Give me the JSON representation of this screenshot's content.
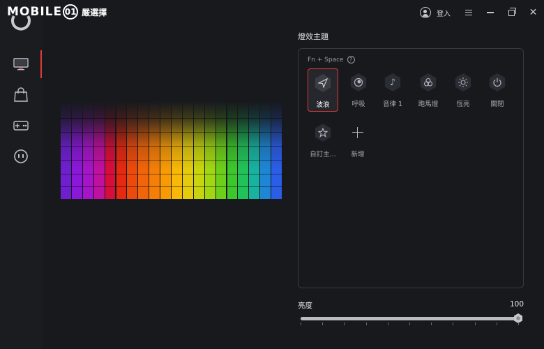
{
  "app": {
    "logo_text": "MOBILE01",
    "logo_subtitle": "嚴選擇"
  },
  "titlebar": {
    "login_label": "登入"
  },
  "sidebar": {
    "items": [
      {
        "name": "monitor",
        "active": true
      },
      {
        "name": "shopping-bag",
        "active": false
      },
      {
        "name": "gamepad",
        "active": false
      },
      {
        "name": "mascot",
        "active": false
      }
    ]
  },
  "lighting": {
    "section_title": "燈效主題",
    "hint": "Fn + Space",
    "effects": [
      {
        "label": "波浪",
        "icon": "send-icon",
        "selected": true
      },
      {
        "label": "呼吸",
        "icon": "breath-icon",
        "selected": false
      },
      {
        "label": "音律 1",
        "icon": "music-note-icon",
        "selected": false
      },
      {
        "label": "跑馬燈",
        "icon": "marquee-icon",
        "selected": false
      },
      {
        "label": "恆亮",
        "icon": "sun-icon",
        "selected": false
      },
      {
        "label": "關閉",
        "icon": "power-icon",
        "selected": false
      },
      {
        "label": "自訂主...",
        "icon": "custom-star-icon",
        "selected": false
      },
      {
        "label": "新增",
        "icon": "plus-icon",
        "selected": false
      }
    ]
  },
  "brightness": {
    "label": "亮度",
    "value": "100",
    "level": 1.0
  },
  "keyboard": {
    "colors": [
      "#6f1fd0",
      "#8a18d8",
      "#a614c8",
      "#c010a0",
      "#d80e3a",
      "#e42a10",
      "#ec4a0c",
      "#f0650a",
      "#f47e08",
      "#f79a06",
      "#f8b808",
      "#e4cc0c",
      "#c8d40e",
      "#a0d612",
      "#6ecf1a",
      "#3cc82a",
      "#22c25a",
      "#18b2a0",
      "#1e86d4",
      "#2a5ee6"
    ]
  }
}
